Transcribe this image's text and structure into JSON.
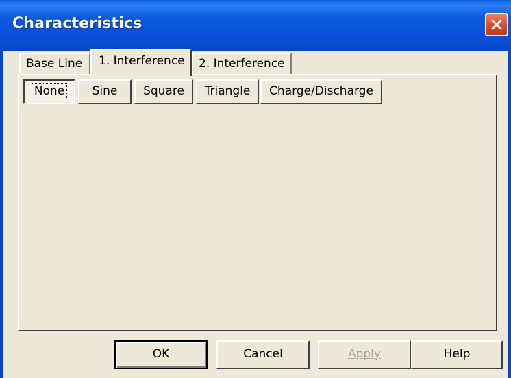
{
  "window": {
    "title": "Characteristics"
  },
  "tabs": [
    {
      "label": "Base Line",
      "active": false
    },
    {
      "label": "1. Interference",
      "active": true
    },
    {
      "label": "2. Interference",
      "active": false
    }
  ],
  "waveform_buttons": [
    {
      "label": "None",
      "selected": true
    },
    {
      "label": "Sine",
      "selected": false
    },
    {
      "label": "Square",
      "selected": false
    },
    {
      "label": "Triangle",
      "selected": false
    },
    {
      "label": "Charge/Discharge",
      "selected": false
    }
  ],
  "dialog_buttons": {
    "ok": "OK",
    "cancel": "Cancel",
    "apply": "Apply",
    "help": "Help"
  },
  "colors": {
    "titlebar": "#0A5FE0",
    "dialog_background": "#ECE9D8",
    "close_button": "#D8552F"
  }
}
